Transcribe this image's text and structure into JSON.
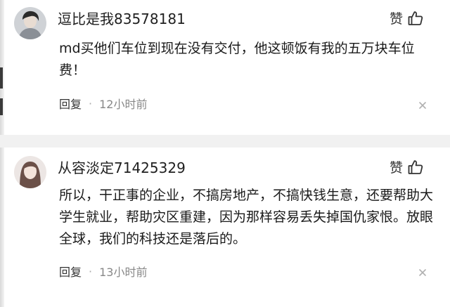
{
  "comments": [
    {
      "username": "逗比是我83578181",
      "content": "md买他们车位到现在没有交付，他这顿饭有我的五万块车位费！",
      "like_label": "赞",
      "reply_label": "回复",
      "separator": "·",
      "time": "12小时前"
    },
    {
      "username": "从容淡定71425329",
      "content": "所以，干正事的企业，不搞房地产，不搞快钱生意，还要帮助大学生就业，帮助灾区重建，因为那样容易丢失掉国仇家恨。放眼全球，我们的科技还是落后的。",
      "like_label": "赞",
      "reply_label": "回复",
      "separator": "·",
      "time": "13小时前"
    }
  ],
  "colors": {
    "text_primary": "#1a1a1a",
    "text_secondary": "#888888",
    "divider": "#f1f1f1",
    "background": "#ffffff"
  },
  "icons": {
    "like": "thumbs-up-icon",
    "close": "close-icon"
  }
}
